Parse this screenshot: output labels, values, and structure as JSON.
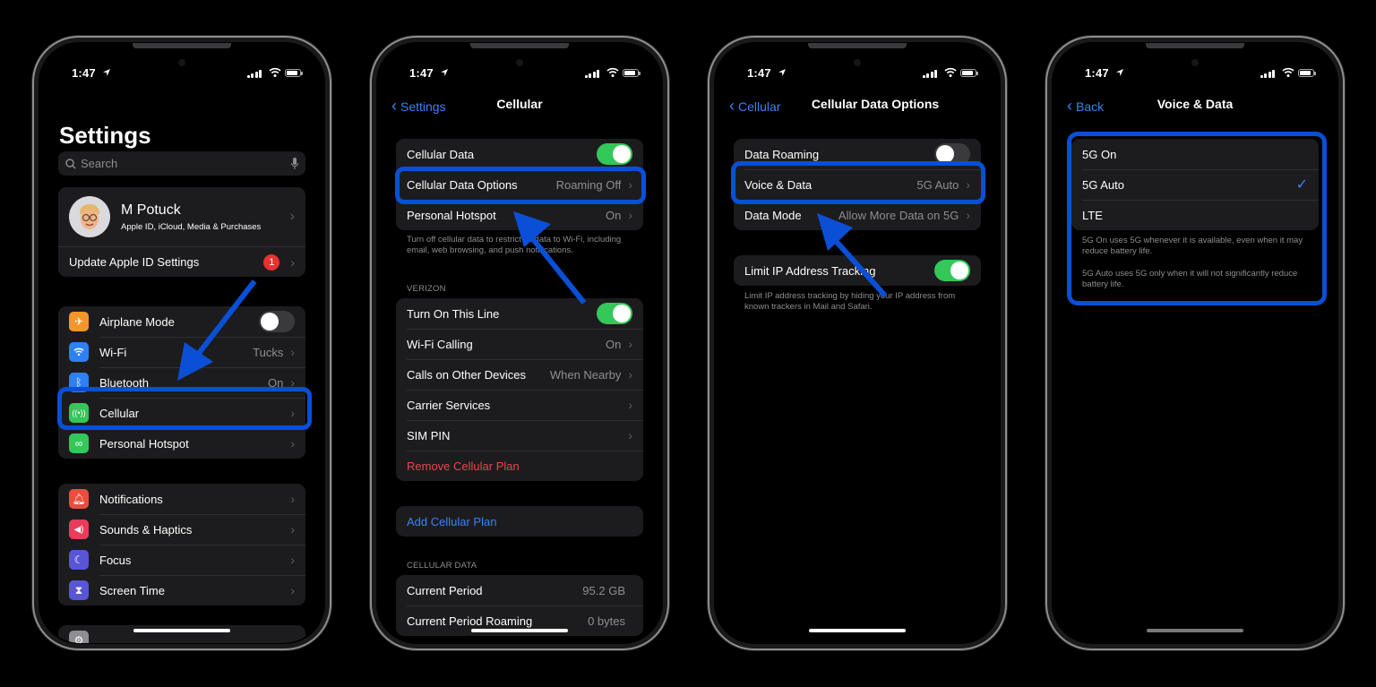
{
  "status_bar": {
    "time": "1:47"
  },
  "phones": [
    {
      "screen": "settings",
      "title": "Settings",
      "search": {
        "placeholder": "Search"
      },
      "profile": {
        "name": "M Potuck",
        "subtitle": "Apple ID, iCloud, Media & Purchases"
      },
      "update_row": {
        "label": "Update Apple ID Settings",
        "badge": "1"
      },
      "group1": [
        {
          "label": "Airplane Mode",
          "icon": "airplane-icon",
          "color": "#f5962b",
          "toggle": "off"
        },
        {
          "label": "Wi-Fi",
          "icon": "wifi-icon",
          "color": "#2f7ff5",
          "value": "Tucks"
        },
        {
          "label": "Bluetooth",
          "icon": "bluetooth-icon",
          "color": "#2f7ff5",
          "value": "On"
        },
        {
          "label": "Cellular",
          "icon": "antenna-icon",
          "color": "#34c759"
        },
        {
          "label": "Personal Hotspot",
          "icon": "hotspot-icon",
          "color": "#34c759"
        }
      ],
      "group2": [
        {
          "label": "Notifications",
          "icon": "bell-icon",
          "color": "#eb4d3d"
        },
        {
          "label": "Sounds & Haptics",
          "icon": "speaker-icon",
          "color": "#eb3b5a"
        },
        {
          "label": "Focus",
          "icon": "moon-icon",
          "color": "#5856d6"
        },
        {
          "label": "Screen Time",
          "icon": "hourglass-icon",
          "color": "#5856d6"
        }
      ]
    },
    {
      "screen": "cellular",
      "back": "Settings",
      "title": "Cellular",
      "group1": [
        {
          "label": "Cellular Data",
          "toggle": "on"
        },
        {
          "label": "Cellular Data Options",
          "value": "Roaming Off"
        },
        {
          "label": "Personal Hotspot",
          "value": "On"
        }
      ],
      "footer1": "Turn off cellular data to restrict all data to Wi-Fi, including email, web browsing, and push notifications.",
      "section_verizon": "VERIZON",
      "group2": [
        {
          "label": "Turn On This Line",
          "toggle": "on"
        },
        {
          "label": "Wi-Fi Calling",
          "value": "On"
        },
        {
          "label": "Calls on Other Devices",
          "value": "When Nearby"
        },
        {
          "label": "Carrier Services",
          "value": ""
        },
        {
          "label": "SIM PIN",
          "value": ""
        },
        {
          "label": "Remove Cellular Plan",
          "style": "destructive"
        }
      ],
      "add_plan": "Add Cellular Plan",
      "section_data": "CELLULAR DATA",
      "group3": [
        {
          "label": "Current Period",
          "value": "95.2 GB"
        },
        {
          "label": "Current Period Roaming",
          "value": "0 bytes"
        }
      ]
    },
    {
      "screen": "cellular-data-options",
      "back": "Cellular",
      "title": "Cellular Data Options",
      "group1": [
        {
          "label": "Data Roaming",
          "toggle": "off"
        },
        {
          "label": "Voice & Data",
          "value": "5G Auto"
        },
        {
          "label": "Data Mode",
          "value": "Allow More Data on 5G"
        }
      ],
      "group2": [
        {
          "label": "Limit IP Address Tracking",
          "toggle": "on"
        }
      ],
      "footer": "Limit IP address tracking by hiding your IP address from known trackers in Mail and Safari."
    },
    {
      "screen": "voice-data",
      "back": "Back",
      "title": "Voice & Data",
      "options": [
        {
          "label": "5G On",
          "selected": false
        },
        {
          "label": "5G Auto",
          "selected": true
        },
        {
          "label": "LTE",
          "selected": false
        }
      ],
      "footer1": "5G On uses 5G whenever it is available, even when it may reduce battery life.",
      "footer2": "5G Auto uses 5G only when it will not significantly reduce battery life."
    }
  ],
  "colors": {
    "accent": "#3b82f6",
    "highlight": "#0a4fd6",
    "toggle_on": "#34c759",
    "destructive": "#e5484d",
    "badge": "#e8322f"
  }
}
